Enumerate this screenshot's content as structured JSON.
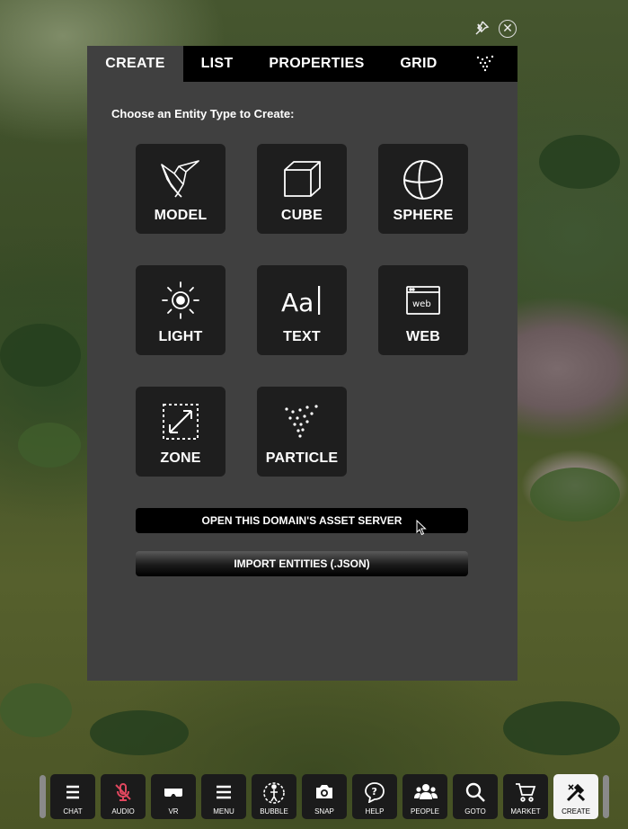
{
  "window": {
    "pin_icon": "pin-icon",
    "close_icon": "close-icon"
  },
  "tabs": [
    {
      "label": "CREATE",
      "active": true
    },
    {
      "label": "LIST",
      "active": false
    },
    {
      "label": "PROPERTIES",
      "active": false
    },
    {
      "label": "GRID",
      "active": false
    },
    {
      "icon": "particle-explorer-icon",
      "active": false
    }
  ],
  "prompt": "Choose an Entity Type to Create:",
  "entities": [
    {
      "label": "MODEL",
      "icon": "model-bird-icon"
    },
    {
      "label": "CUBE",
      "icon": "cube-icon"
    },
    {
      "label": "SPHERE",
      "icon": "sphere-icon"
    },
    {
      "label": "LIGHT",
      "icon": "light-sun-icon"
    },
    {
      "label": "TEXT",
      "icon": "text-icon"
    },
    {
      "label": "WEB",
      "icon": "web-icon"
    },
    {
      "label": "ZONE",
      "icon": "zone-icon"
    },
    {
      "label": "PARTICLE",
      "icon": "particle-icon"
    }
  ],
  "buttons": {
    "asset_server": "OPEN THIS DOMAIN'S ASSET SERVER",
    "import": "IMPORT ENTITIES (.JSON)"
  },
  "toolbar": [
    {
      "label": "CHAT",
      "icon": "chat-icon"
    },
    {
      "label": "AUDIO",
      "icon": "mic-muted-icon",
      "accent": "#e0475e"
    },
    {
      "label": "VR",
      "icon": "vr-headset-icon"
    },
    {
      "label": "MENU",
      "icon": "menu-icon"
    },
    {
      "label": "BUBBLE",
      "icon": "bubble-icon"
    },
    {
      "label": "SNAP",
      "icon": "camera-icon"
    },
    {
      "label": "HELP",
      "icon": "help-icon"
    },
    {
      "label": "PEOPLE",
      "icon": "people-icon"
    },
    {
      "label": "GOTO",
      "icon": "search-icon"
    },
    {
      "label": "MARKET",
      "icon": "cart-icon"
    },
    {
      "label": "CREATE",
      "icon": "create-tools-icon",
      "active": true
    }
  ]
}
